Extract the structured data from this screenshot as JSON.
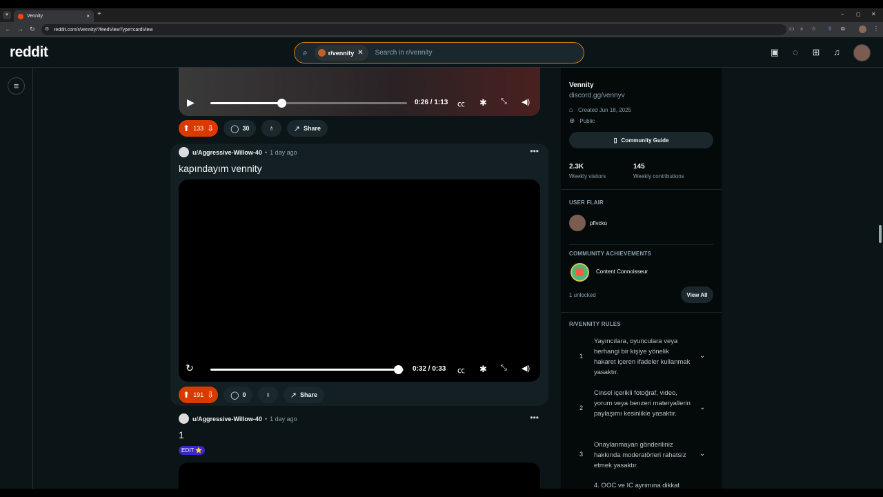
{
  "browser": {
    "tab_title": "Vennity",
    "url": "reddit.com/r/vennity/?feedViewType=cardView",
    "new_tab": "+",
    "tab_close": "×",
    "min": "–",
    "max": "◻",
    "close": "✕"
  },
  "header": {
    "logo": "reddit",
    "search_chip": "r/vennity",
    "search_placeholder": "Search in r/vennity"
  },
  "feed": {
    "post0": {
      "time_current": "0:26",
      "time_total": "1:13",
      "time_text": "0:26 / 1:13",
      "progress": 0.36,
      "score": "133",
      "comments": "30",
      "share": "Share"
    },
    "post1": {
      "user": "u/Aggressive-Willow-40",
      "age": "1 day ago",
      "title": "kapındayım vennity",
      "time_text": "0:32 / 0:33",
      "progress": 0.97,
      "score": "191",
      "comments": "0",
      "share": "Share"
    },
    "post2": {
      "user": "u/Aggressive-Willow-40",
      "age": "1 day ago",
      "title": "1",
      "flair": "EDIT ⭐"
    }
  },
  "sidebar": {
    "name": "Vennity",
    "link": "discord.gg/vennyv",
    "created": "Created Jun 18, 2025",
    "visibility": "Public",
    "guide_button": "Community Guide",
    "stats": [
      {
        "value": "2.3K",
        "label": "Weekly visitors"
      },
      {
        "value": "145",
        "label": "Weekly contributions"
      }
    ],
    "user_flair_head": "USER FLAIR",
    "user_flair_name": "pflvcko",
    "achievements_head": "COMMUNITY ACHIEVEMENTS",
    "achievement": "Content Connoisseur",
    "unlocked": "1 unlocked",
    "view_all": "View All",
    "rules_head": "R/VENNITY RULES",
    "rules": [
      {
        "num": "1",
        "text": "Yayıncılara, oyunculara veya herhangi bir kişiye yönelik hakaret içeren ifadeler kullanmak yasaktır."
      },
      {
        "num": "2",
        "text": "Cinsel içerikli fotoğraf, video, yorum veya benzeri materyallerin paylaşımı kesinlikle yasaktır."
      },
      {
        "num": "3",
        "text": "Onaylanmayan gönderiliniz hakkında moderatörleri rahatsız etmek yasaktır."
      },
      {
        "num": "",
        "text": "4. OOC ve IC ayrımına dikkat"
      }
    ]
  }
}
